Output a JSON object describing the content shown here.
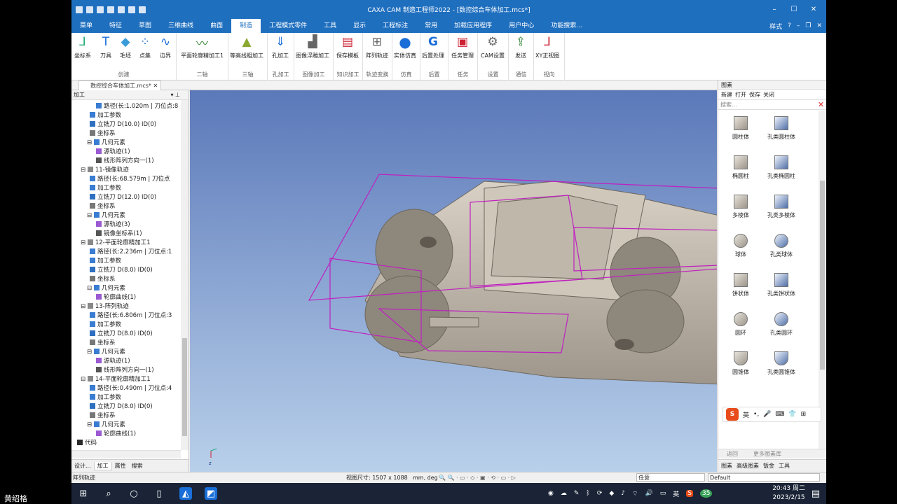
{
  "titlebar": {
    "title": "CAXA CAM 制造工程师2022 - [数控综合车体加工.mcs*]"
  },
  "menubar": {
    "items": [
      "菜单",
      "特征",
      "草图",
      "三维曲线",
      "曲面",
      "制造",
      "工程模式零件",
      "工具",
      "显示",
      "工程标注",
      "常用",
      "加载应用程序",
      "用户中心",
      "功能搜索..."
    ],
    "right_label": "样式"
  },
  "ribbon": {
    "buttons": [
      "坐标系",
      "刀具",
      "毛坯",
      "点集",
      "边界",
      "平面轮廓精加工1",
      "等高线粗加工",
      "孔加工",
      "图像浮雕加工",
      "保存模板",
      "阵列轨迹",
      "实体仿真",
      "后置处理",
      "任务管理",
      "CAM设置",
      "发送",
      "XY正视图"
    ],
    "groups": [
      "创建",
      "二轴",
      "三轴",
      "孔加工",
      "图像加工",
      "知识加工",
      "轨迹变换",
      "仿真",
      "后置",
      "任务",
      "设置",
      "通信",
      "视向"
    ]
  },
  "doc_tab": "数控综合车体加工.mcs*",
  "left_panel": {
    "header": "加工",
    "tree": [
      "路径(长:1.020m | 刀位点:8",
      "加工参数",
      "立铣刀 D(10.0) ID(0)",
      "坐标系",
      "几何元素",
      "源轨迹(1)",
      "线形阵列方向一(1)",
      "11-镜像轨迹",
      "路径(长:68.579m | 刀位点",
      "加工参数",
      "立铣刀 D(12.0) ID(0)",
      "坐标系",
      "几何元素",
      "源轨迹(3)",
      "镜像坐标系(1)",
      "12-平面轮廓精加工1",
      "路径(长:2.236m | 刀位点:1",
      "加工参数",
      "立铣刀 D(8.0) ID(0)",
      "坐标系",
      "几何元素",
      "轮廓曲线(1)",
      "13-阵列轨迹",
      "路径(长:6.806m | 刀位点:3",
      "加工参数",
      "立铣刀 D(8.0) ID(0)",
      "坐标系",
      "几何元素",
      "源轨迹(1)",
      "线形阵列方向一(1)",
      "14-平面轮廓精加工1",
      "路径(长:0.490m | 刀位点:4",
      "加工参数",
      "立铣刀 D(8.0) ID(0)",
      "坐标系",
      "几何元素",
      "轮廓曲线(1)",
      "代码"
    ],
    "tabs": [
      "设计...",
      "加工",
      "属性",
      "搜索"
    ]
  },
  "viewport": {
    "axis_label": "z"
  },
  "right_panel": {
    "header": "图素",
    "tools": [
      "新建",
      "打开",
      "保存",
      "关闭"
    ],
    "search_placeholder": "搜索...",
    "items": [
      "圆柱体",
      "孔类圆柱体",
      "椭圆柱",
      "孔类椭圆柱",
      "多棱体",
      "孔类多棱体",
      "球体",
      "孔类球体",
      "饼状体",
      "孔类饼状体",
      "圆环",
      "孔类圆环",
      "圆锥体",
      "孔类圆锥体"
    ],
    "ime_label": "英",
    "nav": [
      "返回",
      "更多图素库"
    ],
    "tabs": [
      "图素",
      "高级图素",
      "钣金",
      "工具"
    ]
  },
  "statusbar": {
    "left": "阵列轨迹",
    "view_size": "视图尺寸: 1507 x 1088",
    "units": "mm, deg",
    "select_mode": "任意",
    "style": "Default"
  },
  "taskbar": {
    "time": "20:43 周二",
    "date": "2023/2/15",
    "ime": "英",
    "badge": "35",
    "user": "黄绍格"
  }
}
